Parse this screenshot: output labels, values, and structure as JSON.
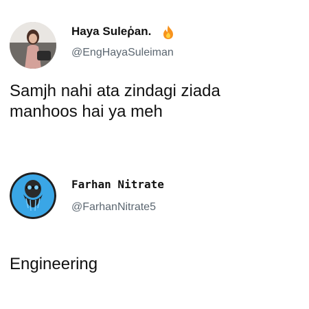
{
  "posts": [
    {
      "author_name": "Haya Suleῥan.",
      "author_handle": "@EngHayaSuleiman",
      "name_emoji_icon": "fire-icon",
      "text_line1": "Samjh nahi ata zindagi ziada",
      "text_line2": "manhoos hai ya meh"
    },
    {
      "author_name": "Farhan Nitrate",
      "author_handle": "@FarhanNitrate5",
      "text_line1": "Engineering"
    }
  ],
  "colors": {
    "text_primary": "#111111",
    "handle_gray": "#5b6670",
    "avatar2_ring": "#3aa6e6",
    "flame_orange": "#f7931e"
  }
}
